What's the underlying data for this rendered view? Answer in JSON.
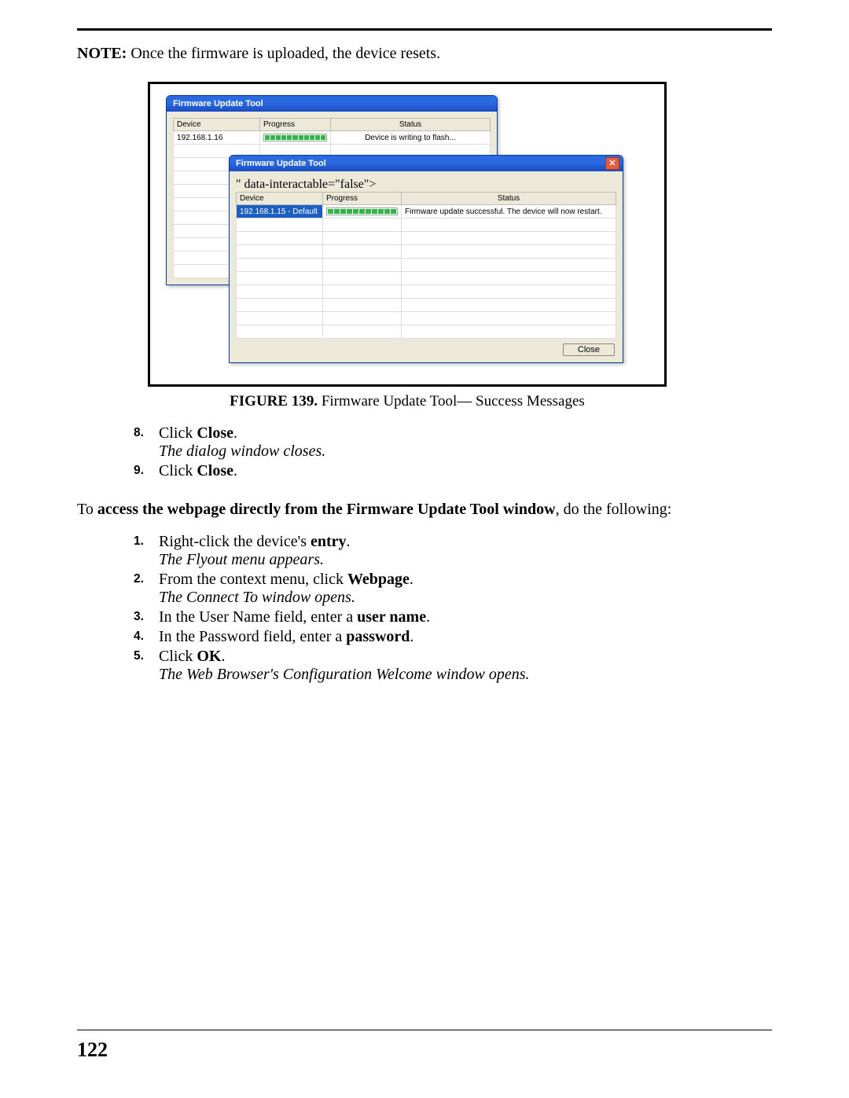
{
  "note": {
    "label": "NOTE:",
    "text": " Once the firmware is uploaded, the device resets."
  },
  "figure": {
    "window_title": "Firmware Update Tool",
    "columns": {
      "device": "Device",
      "progress": "Progress",
      "status": "Status"
    },
    "back_window": {
      "row": {
        "device": "192.168.1.16",
        "status": "Device is writing to flash..."
      }
    },
    "front_window": {
      "row": {
        "device": "192.168.1.15 - Default",
        "status": "Firmware update successful. The device will now restart."
      },
      "close_button": "Close"
    },
    "caption_prefix": "FIGURE 139.",
    "caption_text": "  Firmware Update Tool— Success Messages"
  },
  "steps_a": [
    {
      "num": "8.",
      "text_pre": "Click ",
      "bold": "Close",
      "text_post": ".",
      "result": "The dialog window closes."
    },
    {
      "num": "9.",
      "text_pre": "Click ",
      "bold": "Close",
      "text_post": "."
    }
  ],
  "mid_para": {
    "pre": "To ",
    "bold": "access the webpage directly from the Firmware Update Tool window",
    "post": ", do the following:"
  },
  "steps_b": [
    {
      "num": "1.",
      "text_pre": "Right-click the device's ",
      "bold": "entry",
      "text_post": ".",
      "result": "The Flyout menu appears."
    },
    {
      "num": "2.",
      "text_pre": "From the context menu, click ",
      "bold": "Webpage",
      "text_post": ".",
      "result": "The Connect To window opens."
    },
    {
      "num": "3.",
      "text_pre": "In the User Name field, enter a ",
      "bold": "user name",
      "text_post": "."
    },
    {
      "num": "4.",
      "text_pre": "In the Password field, enter a ",
      "bold": "password",
      "text_post": "."
    },
    {
      "num": "5.",
      "text_pre": "Click ",
      "bold": "OK",
      "text_post": ".",
      "result": "The Web Browser's Configuration Welcome window opens."
    }
  ],
  "page_number": "122"
}
